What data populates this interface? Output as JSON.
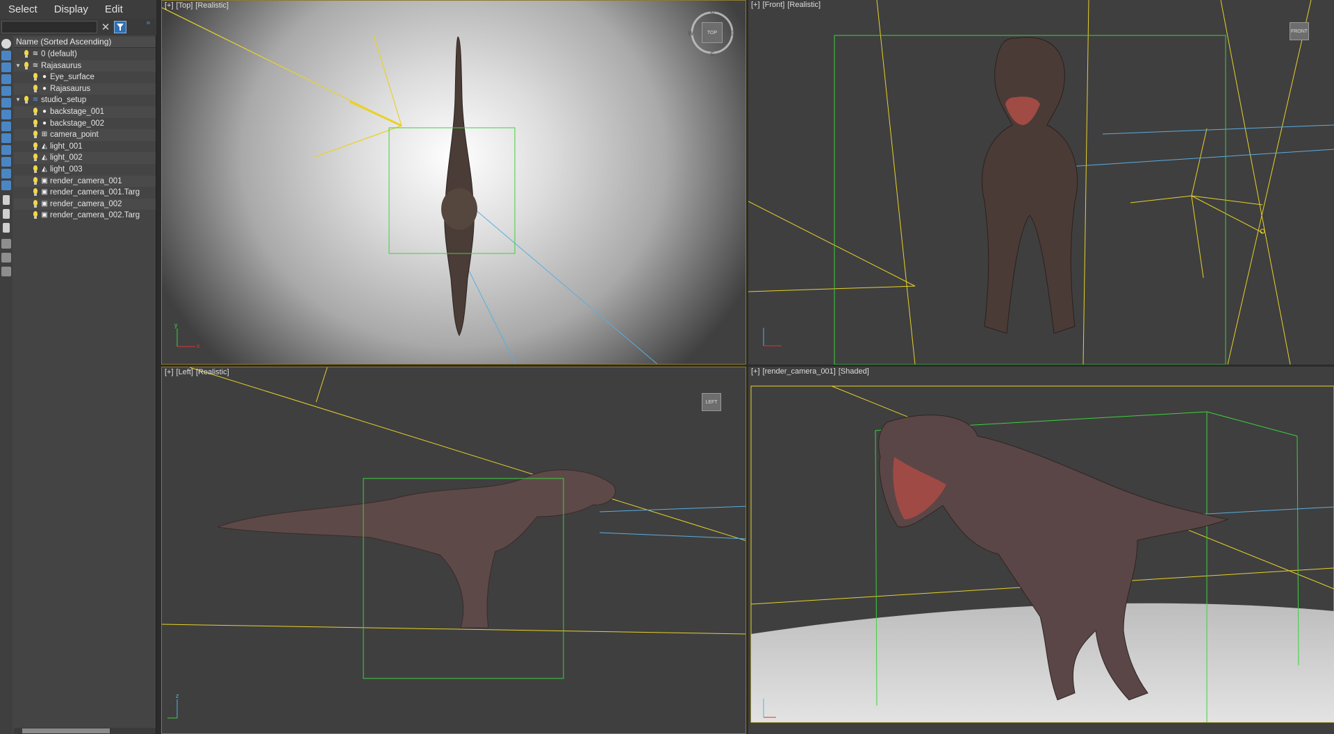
{
  "menu": [
    "Select",
    "Display",
    "Edit"
  ],
  "search": {
    "value": "",
    "clear_glyph": "✕",
    "case_icon": "filter-icon"
  },
  "tree": {
    "header": "Name (Sorted Ascending)",
    "rows": [
      {
        "label": "0 (default)",
        "level": 0,
        "icon": "layer-icon",
        "expand": ""
      },
      {
        "label": "Rajasaurus",
        "level": 0,
        "icon": "layer-icon",
        "expand": "▼"
      },
      {
        "label": "Eye_surface",
        "level": 1,
        "icon": "sphere-icon",
        "expand": ""
      },
      {
        "label": "Rajasaurus",
        "level": 1,
        "icon": "sphere-icon",
        "expand": ""
      },
      {
        "label": "studio_setup",
        "level": 0,
        "icon": "layer-active-icon",
        "expand": "▼"
      },
      {
        "label": "backstage_001",
        "level": 1,
        "icon": "sphere-icon",
        "expand": ""
      },
      {
        "label": "backstage_002",
        "level": 1,
        "icon": "sphere-icon",
        "expand": ""
      },
      {
        "label": "camera_point",
        "level": 1,
        "icon": "helper-icon",
        "expand": ""
      },
      {
        "label": "light_001",
        "level": 1,
        "icon": "light-icon",
        "expand": ""
      },
      {
        "label": "light_002",
        "level": 1,
        "icon": "light-icon",
        "expand": ""
      },
      {
        "label": "light_003",
        "level": 1,
        "icon": "light-icon",
        "expand": ""
      },
      {
        "label": "render_camera_001",
        "level": 1,
        "icon": "camera-icon",
        "expand": ""
      },
      {
        "label": "render_camera_001.Targ",
        "level": 1,
        "icon": "camera-icon",
        "expand": ""
      },
      {
        "label": "render_camera_002",
        "level": 1,
        "icon": "camera-icon",
        "expand": ""
      },
      {
        "label": "render_camera_002.Targ",
        "level": 1,
        "icon": "camera-icon",
        "expand": ""
      }
    ]
  },
  "viewports": {
    "top": {
      "plus": "[+]",
      "view": "[Top]",
      "shading": "[Realistic]",
      "cube": "TOP",
      "compass": [
        "N",
        "E",
        "S",
        "W"
      ]
    },
    "front": {
      "plus": "[+]",
      "view": "[Front]",
      "shading": "[Realistic]",
      "cube": "FRONT"
    },
    "left": {
      "plus": "[+]",
      "view": "[Left]",
      "shading": "[Realistic]",
      "cube": "LEFT"
    },
    "camera": {
      "plus": "[+]",
      "view": "[render_camera_001]",
      "shading": "[Shaded]"
    }
  },
  "axis_labels": {
    "x": "x",
    "y": "y",
    "z": "z"
  },
  "colors": {
    "selection_box": "#3dd13d",
    "light_line": "#e8d22a",
    "camera_line": "#5aaee0",
    "active_border": "#8d7a2d"
  }
}
